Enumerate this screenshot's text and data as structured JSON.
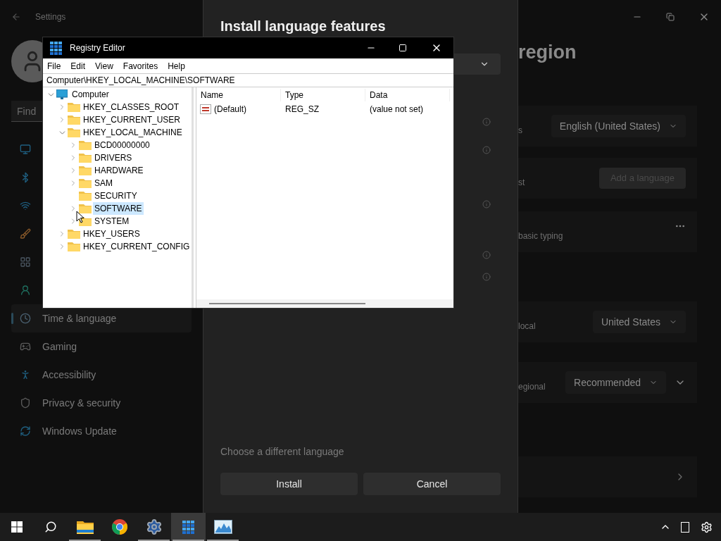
{
  "settings": {
    "title": "Settings",
    "search": {
      "placeholder": "Find"
    },
    "sidebar": {
      "items": [
        {
          "kind": "system",
          "selected": false
        },
        {
          "kind": "bluetooth",
          "selected": false
        },
        {
          "kind": "network",
          "selected": false
        },
        {
          "kind": "personalization",
          "selected": false
        },
        {
          "kind": "apps",
          "selected": false
        },
        {
          "kind": "accounts",
          "selected": false
        },
        {
          "kind": "time",
          "label": "Time & language",
          "selected": true
        },
        {
          "kind": "gaming",
          "label": "Gaming",
          "selected": false
        },
        {
          "kind": "accessibility",
          "label": "Accessibility",
          "selected": false
        },
        {
          "kind": "privacy",
          "label": "Privacy & security",
          "selected": false
        },
        {
          "kind": "update",
          "label": "Windows Update",
          "selected": false
        }
      ]
    },
    "page_title": "region",
    "rows": [
      {
        "kind": "dropdown",
        "label": "s",
        "value": "English (United States)"
      },
      {
        "kind": "button",
        "label": "st",
        "button": "Add a language"
      },
      {
        "kind": "more",
        "label": "basic typing"
      },
      {
        "kind": "dropdown",
        "label": "local",
        "value": "United States"
      },
      {
        "kind": "dropdown",
        "label": "egional",
        "value": "Recommended",
        "expandable": true
      },
      {
        "kind": "link"
      }
    ]
  },
  "dialog": {
    "title": "Install language features",
    "link": "Choose a different language",
    "buttons": [
      "Install",
      "Cancel"
    ]
  },
  "registry": {
    "title": "Registry Editor",
    "menu": [
      "File",
      "Edit",
      "View",
      "Favorites",
      "Help"
    ],
    "address": "Computer\\HKEY_LOCAL_MACHINE\\SOFTWARE",
    "tree": [
      {
        "label": "Computer",
        "kind": "computer",
        "has_children": true,
        "selected": false,
        "children": [
          {
            "label": "HKEY_CLASSES_ROOT",
            "kind": "folder",
            "has_children": true,
            "selected": false
          },
          {
            "label": "HKEY_CURRENT_USER",
            "kind": "folder",
            "has_children": true,
            "selected": false
          },
          {
            "label": "HKEY_LOCAL_MACHINE",
            "kind": "folder",
            "has_children": true,
            "selected": false,
            "children": [
              {
                "label": "BCD00000000",
                "kind": "folder",
                "has_children": true,
                "selected": false
              },
              {
                "label": "DRIVERS",
                "kind": "folder",
                "has_children": true,
                "selected": false
              },
              {
                "label": "HARDWARE",
                "kind": "folder",
                "has_children": true,
                "selected": false
              },
              {
                "label": "SAM",
                "kind": "folder",
                "has_children": true,
                "selected": false
              },
              {
                "label": "SECURITY",
                "kind": "folder",
                "has_children": false,
                "selected": false
              },
              {
                "label": "SOFTWARE",
                "kind": "folder",
                "has_children": true,
                "selected": true
              },
              {
                "label": "SYSTEM",
                "kind": "folder",
                "has_children": true,
                "selected": false
              }
            ]
          },
          {
            "label": "HKEY_USERS",
            "kind": "folder",
            "has_children": true,
            "selected": false
          },
          {
            "label": "HKEY_CURRENT_CONFIG",
            "kind": "folder",
            "has_children": true,
            "selected": false
          }
        ]
      }
    ],
    "columns": [
      "Name",
      "Type",
      "Data"
    ],
    "rows": [
      {
        "name": "(Default)",
        "type": "REG_SZ",
        "data": "(value not set)"
      }
    ]
  },
  "taskbar": {
    "apps": [
      {
        "kind": "explorer",
        "open": true,
        "selected": false
      },
      {
        "kind": "chrome",
        "open": false,
        "selected": false
      },
      {
        "kind": "settings",
        "open": true,
        "selected": false
      },
      {
        "kind": "regedit",
        "open": true,
        "selected": true
      },
      {
        "kind": "perfmon",
        "open": true,
        "selected": false
      }
    ]
  }
}
